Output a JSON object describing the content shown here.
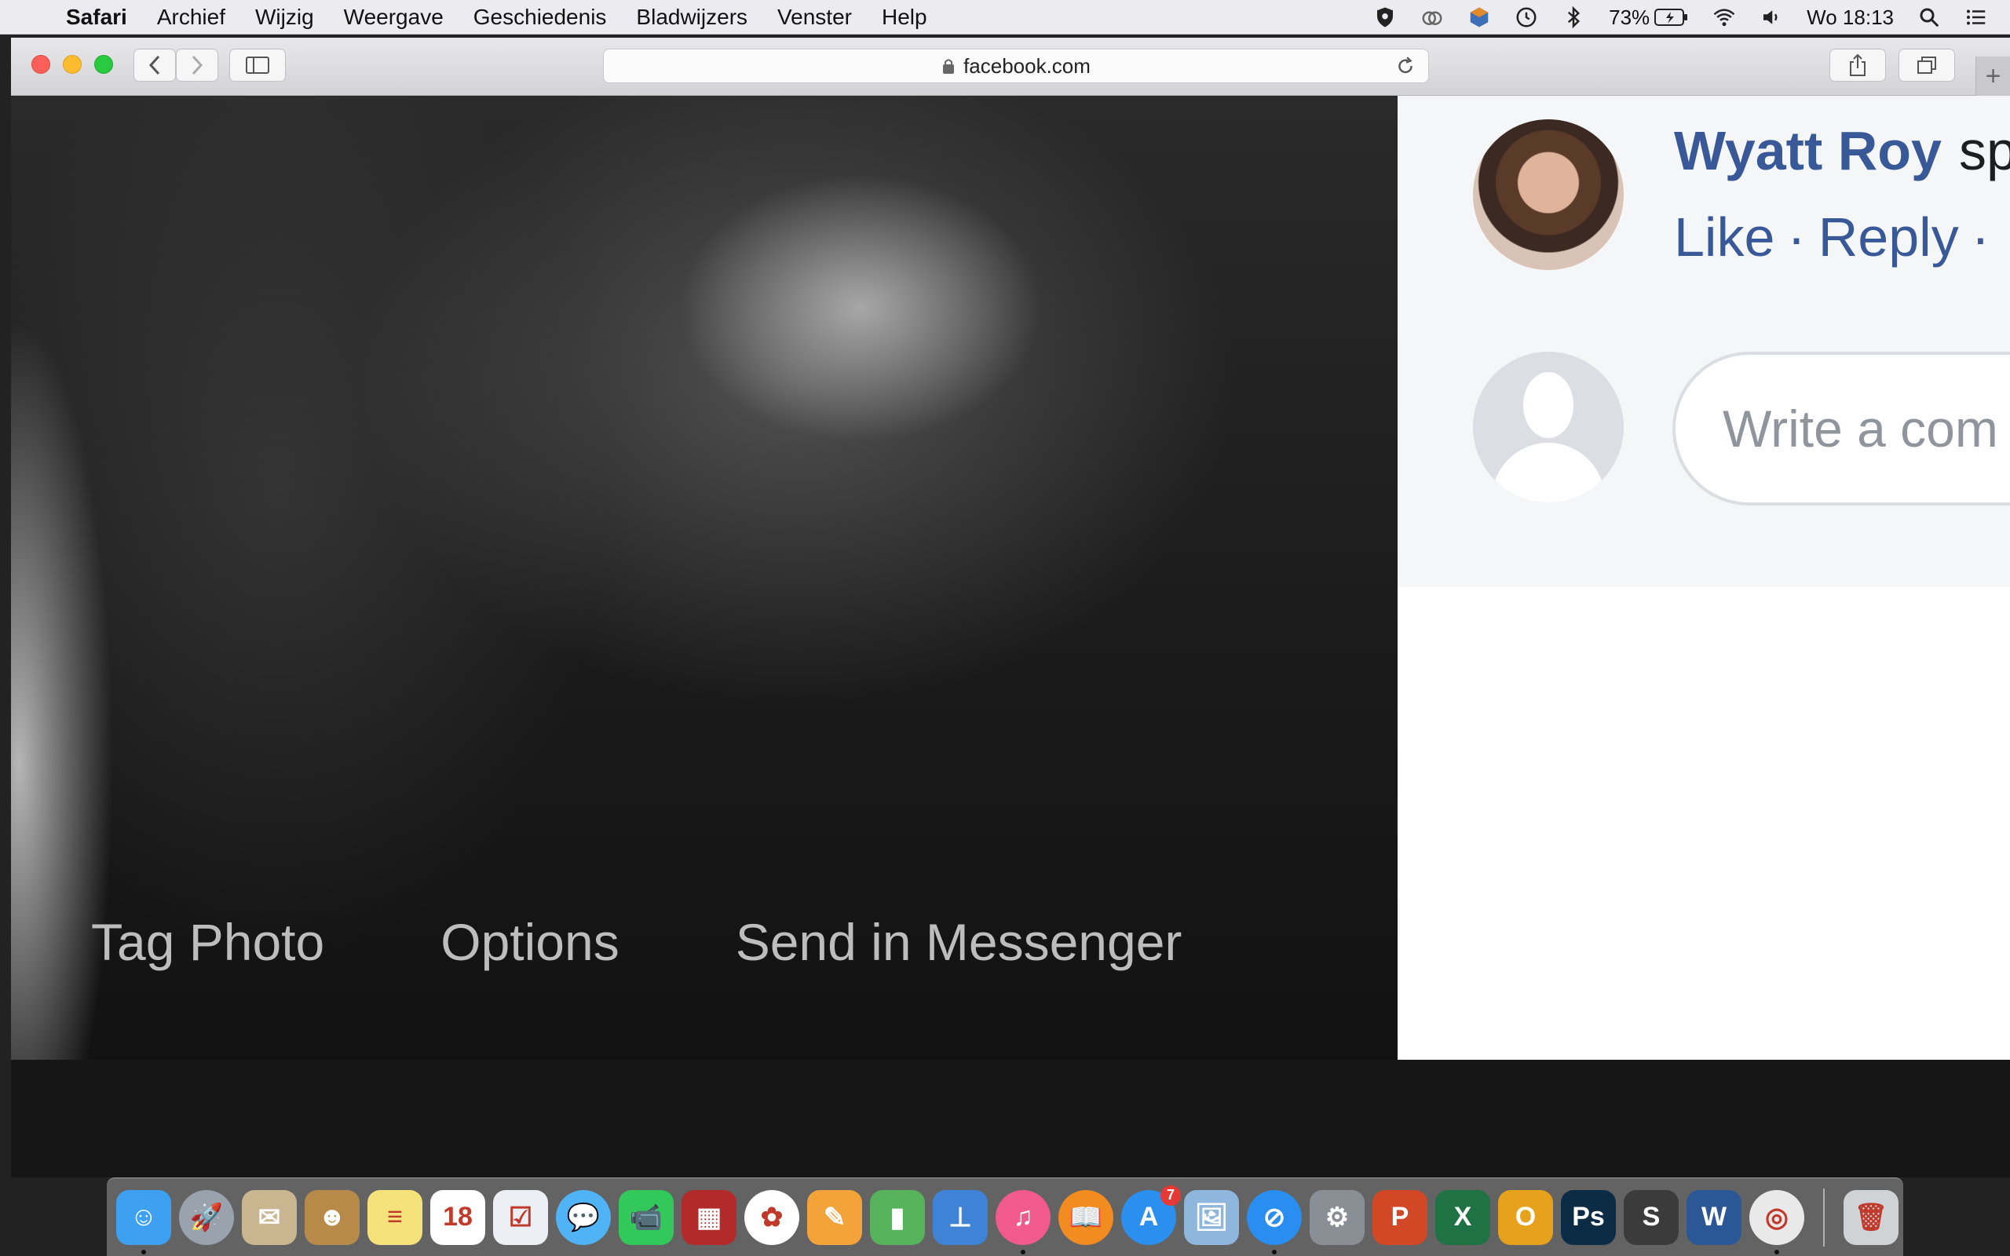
{
  "menubar": {
    "items": [
      "Safari",
      "Archief",
      "Wijzig",
      "Weergave",
      "Geschiedenis",
      "Bladwijzers",
      "Venster",
      "Help"
    ],
    "battery": "73%",
    "clock": "Wo 18:13"
  },
  "browser": {
    "url": "facebook.com"
  },
  "photo": {
    "actions": [
      "Tag Photo",
      "Options",
      "Send in Messenger"
    ]
  },
  "comments": {
    "author": "Wyatt Roy",
    "author_trail": "sp",
    "actions": [
      "Like",
      "Reply"
    ],
    "write_placeholder": "Write a com"
  },
  "dock": {
    "apps": [
      {
        "icon": "finder-icon",
        "color": "#3ea0f0",
        "glyph": "☺",
        "running": true
      },
      {
        "icon": "launchpad-icon",
        "color": "#9aa3ad",
        "glyph": "🚀",
        "running": false
      },
      {
        "icon": "mail-stamp-icon",
        "color": "#c9b690",
        "glyph": "✉",
        "running": false
      },
      {
        "icon": "contacts-icon",
        "color": "#b88a4a",
        "glyph": "☻",
        "running": false
      },
      {
        "icon": "notes-icon",
        "color": "#f6e27a",
        "glyph": "≡",
        "running": false
      },
      {
        "icon": "calendar-icon",
        "color": "#ffffff",
        "glyph": "18",
        "running": false
      },
      {
        "icon": "reminders-icon",
        "color": "#eceff3",
        "glyph": "☑",
        "running": false
      },
      {
        "icon": "messages-icon",
        "color": "#4fb3f6",
        "glyph": "💬",
        "running": false
      },
      {
        "icon": "facetime-icon",
        "color": "#33c85a",
        "glyph": "📹",
        "running": false
      },
      {
        "icon": "photo-booth-icon",
        "color": "#b32a2a",
        "glyph": "▦",
        "running": false
      },
      {
        "icon": "photos-icon",
        "color": "#ffffff",
        "glyph": "✿",
        "running": false
      },
      {
        "icon": "pages-icon",
        "color": "#f2a33a",
        "glyph": "✎",
        "running": false
      },
      {
        "icon": "numbers-icon",
        "color": "#56b35b",
        "glyph": "▮",
        "running": false
      },
      {
        "icon": "keynote-icon",
        "color": "#3f83d6",
        "glyph": "⊥",
        "running": false
      },
      {
        "icon": "itunes-icon",
        "color": "#f05a8c",
        "glyph": "♫",
        "running": true
      },
      {
        "icon": "ibooks-icon",
        "color": "#f28b20",
        "glyph": "📖",
        "running": false
      },
      {
        "icon": "app-store-icon",
        "color": "#2b8ff0",
        "glyph": "A",
        "running": false,
        "badge": "7"
      },
      {
        "icon": "preview-icon",
        "color": "#8fb6dc",
        "glyph": "🖼",
        "running": false
      },
      {
        "icon": "safari-icon",
        "color": "#2a8ef0",
        "glyph": "⊘",
        "running": true
      },
      {
        "icon": "system-preferences-icon",
        "color": "#8a8f96",
        "glyph": "⚙",
        "running": false
      },
      {
        "icon": "powerpoint-icon",
        "color": "#d24726",
        "glyph": "P",
        "running": false
      },
      {
        "icon": "excel-icon",
        "color": "#1f7244",
        "glyph": "X",
        "running": false
      },
      {
        "icon": "outlook-icon",
        "color": "#e6a21c",
        "glyph": "O",
        "running": false
      },
      {
        "icon": "photoshop-icon",
        "color": "#0c2b45",
        "glyph": "Ps",
        "running": false
      },
      {
        "icon": "sublime-text-icon",
        "color": "#3b3b3b",
        "glyph": "S",
        "running": false
      },
      {
        "icon": "word-icon",
        "color": "#2b5797",
        "glyph": "W",
        "running": false
      },
      {
        "icon": "chrome-icon",
        "color": "#e9e9e9",
        "glyph": "◎",
        "running": true
      }
    ],
    "trash": {
      "icon": "trash-icon",
      "color": "#cfd3d6",
      "glyph": "🗑"
    }
  }
}
